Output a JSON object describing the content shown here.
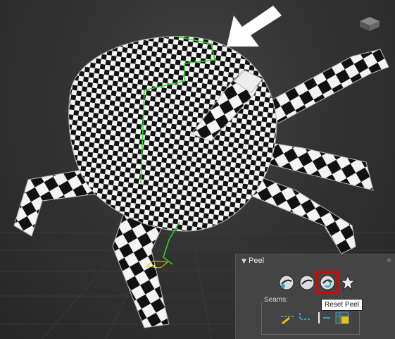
{
  "rollout": {
    "title": "Peel",
    "toggle_icon": "expand-collapse-triangle",
    "grip_icon": "drag-grip"
  },
  "peel_buttons": [
    {
      "icon": "quick-peel-icon"
    },
    {
      "icon": "peel-icon"
    },
    {
      "icon": "reset-peel-icon",
      "highlighted": true
    },
    {
      "icon": "pin-icon"
    }
  ],
  "seams": {
    "label": "Seams:",
    "tools": [
      {
        "icon": "point-to-point-seam-icon"
      },
      {
        "icon": "edit-seams-icon"
      },
      {
        "icon": "edge-to-seam-icon"
      },
      {
        "icon": "expand-seam-icon"
      }
    ]
  },
  "tooltip": {
    "text": "Reset Peel"
  },
  "colors": {
    "highlight": "#e00000",
    "seam": "#22dd22",
    "panel_bg": "#444444",
    "viewport_bg": "#333333",
    "gizmo": "#f2c200"
  },
  "viewport": {
    "callout_icon": "white-arrow-icon",
    "navigation_icon": "viewcube-icon"
  }
}
